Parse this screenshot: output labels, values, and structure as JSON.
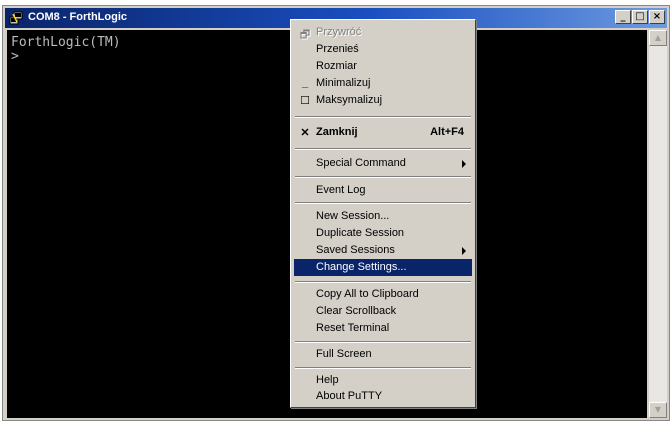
{
  "window": {
    "title": "COM8 - ForthLogic",
    "buttons": {
      "minimize": "_",
      "maximize": "□",
      "close": "×"
    }
  },
  "terminal": {
    "lines": [
      "ForthLogic(TM)",
      ">"
    ]
  },
  "menu": {
    "items": [
      {
        "label": "Przywróć",
        "disabled": true,
        "icon": "restore-icon"
      },
      {
        "label": "Przenieś"
      },
      {
        "label": "Rozmiar"
      },
      {
        "label": "Minimalizuj",
        "icon": "minimize-icon"
      },
      {
        "label": "Maksymalizuj",
        "icon": "maximize-icon"
      },
      {
        "label": "Zamknij",
        "accelerator": "Alt+F4",
        "bold": true,
        "icon": "close-icon"
      },
      {
        "label": "Special Command",
        "submenu": true
      },
      {
        "label": "Event Log"
      },
      {
        "label": "New Session..."
      },
      {
        "label": "Duplicate Session"
      },
      {
        "label": "Saved Sessions",
        "submenu": true
      },
      {
        "label": "Change Settings...",
        "selected": true
      },
      {
        "label": "Copy All to Clipboard"
      },
      {
        "label": "Clear Scrollback"
      },
      {
        "label": "Reset Terminal"
      },
      {
        "label": "Full Screen"
      },
      {
        "label": "Help"
      },
      {
        "label": "About PuTTY"
      }
    ]
  },
  "colors": {
    "title_gradient_start": "#0a246a",
    "selection": "#0a246a",
    "terminal_bg": "#000000",
    "terminal_fg": "#bbbbbb"
  }
}
